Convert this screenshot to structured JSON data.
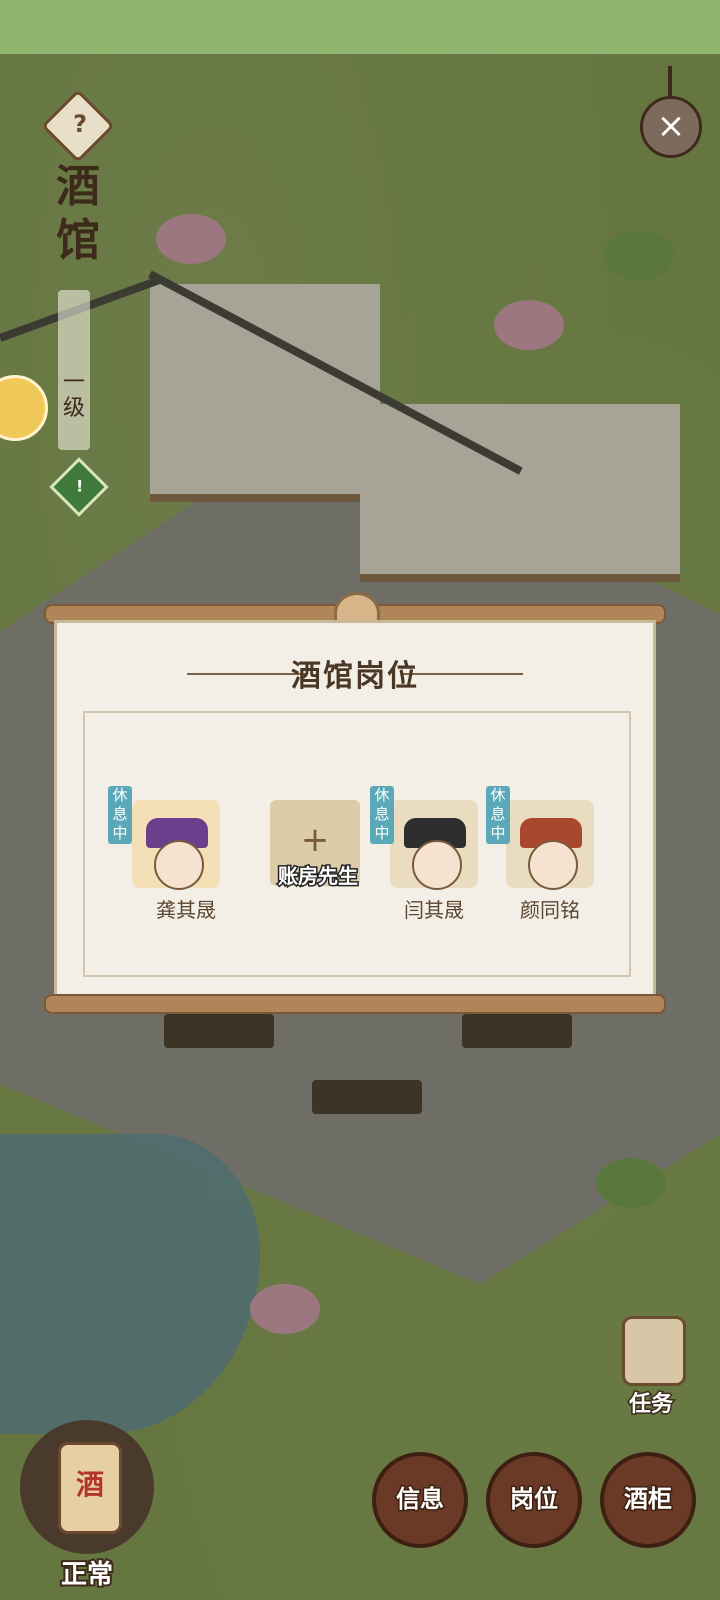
{
  "header": {
    "help_icon": "?",
    "title_line1": "酒",
    "title_line2": "馆",
    "level": "一级",
    "badge": "!"
  },
  "close_icon": "×",
  "modal": {
    "title": "酒馆岗位",
    "staff": [
      {
        "name": "龚其晟",
        "status": "休息中"
      },
      {
        "name": "闫其晟",
        "status": "休息中"
      },
      {
        "name": "颜同铭",
        "status": "休息中"
      }
    ],
    "add_slot": {
      "label": "账房先生",
      "icon": "+"
    }
  },
  "bottom": {
    "task_label": "任务",
    "status_label": "正常",
    "status_icon_text": "酒",
    "buttons": [
      "信息",
      "岗位",
      "酒柜"
    ]
  }
}
